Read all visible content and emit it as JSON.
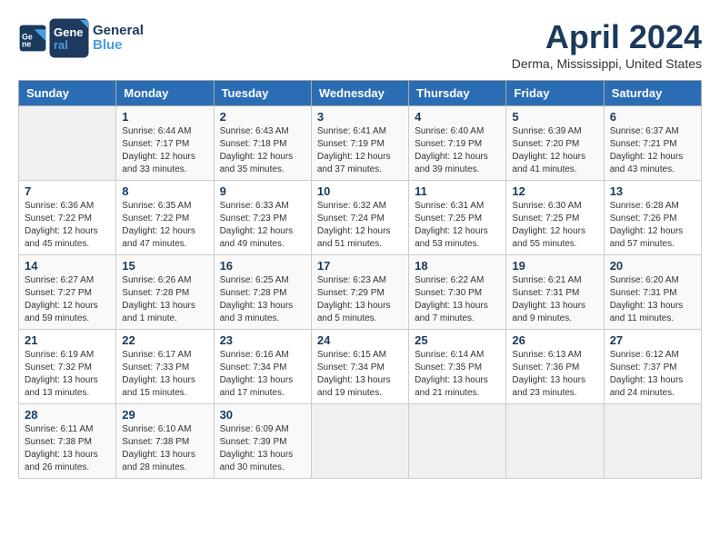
{
  "header": {
    "logo_line1": "General",
    "logo_line2": "Blue",
    "title": "April 2024",
    "location": "Derma, Mississippi, United States"
  },
  "days_of_week": [
    "Sunday",
    "Monday",
    "Tuesday",
    "Wednesday",
    "Thursday",
    "Friday",
    "Saturday"
  ],
  "weeks": [
    [
      {
        "day": "",
        "info": ""
      },
      {
        "day": "1",
        "info": "Sunrise: 6:44 AM\nSunset: 7:17 PM\nDaylight: 12 hours\nand 33 minutes."
      },
      {
        "day": "2",
        "info": "Sunrise: 6:43 AM\nSunset: 7:18 PM\nDaylight: 12 hours\nand 35 minutes."
      },
      {
        "day": "3",
        "info": "Sunrise: 6:41 AM\nSunset: 7:19 PM\nDaylight: 12 hours\nand 37 minutes."
      },
      {
        "day": "4",
        "info": "Sunrise: 6:40 AM\nSunset: 7:19 PM\nDaylight: 12 hours\nand 39 minutes."
      },
      {
        "day": "5",
        "info": "Sunrise: 6:39 AM\nSunset: 7:20 PM\nDaylight: 12 hours\nand 41 minutes."
      },
      {
        "day": "6",
        "info": "Sunrise: 6:37 AM\nSunset: 7:21 PM\nDaylight: 12 hours\nand 43 minutes."
      }
    ],
    [
      {
        "day": "7",
        "info": "Sunrise: 6:36 AM\nSunset: 7:22 PM\nDaylight: 12 hours\nand 45 minutes."
      },
      {
        "day": "8",
        "info": "Sunrise: 6:35 AM\nSunset: 7:22 PM\nDaylight: 12 hours\nand 47 minutes."
      },
      {
        "day": "9",
        "info": "Sunrise: 6:33 AM\nSunset: 7:23 PM\nDaylight: 12 hours\nand 49 minutes."
      },
      {
        "day": "10",
        "info": "Sunrise: 6:32 AM\nSunset: 7:24 PM\nDaylight: 12 hours\nand 51 minutes."
      },
      {
        "day": "11",
        "info": "Sunrise: 6:31 AM\nSunset: 7:25 PM\nDaylight: 12 hours\nand 53 minutes."
      },
      {
        "day": "12",
        "info": "Sunrise: 6:30 AM\nSunset: 7:25 PM\nDaylight: 12 hours\nand 55 minutes."
      },
      {
        "day": "13",
        "info": "Sunrise: 6:28 AM\nSunset: 7:26 PM\nDaylight: 12 hours\nand 57 minutes."
      }
    ],
    [
      {
        "day": "14",
        "info": "Sunrise: 6:27 AM\nSunset: 7:27 PM\nDaylight: 12 hours\nand 59 minutes."
      },
      {
        "day": "15",
        "info": "Sunrise: 6:26 AM\nSunset: 7:28 PM\nDaylight: 13 hours\nand 1 minute."
      },
      {
        "day": "16",
        "info": "Sunrise: 6:25 AM\nSunset: 7:28 PM\nDaylight: 13 hours\nand 3 minutes."
      },
      {
        "day": "17",
        "info": "Sunrise: 6:23 AM\nSunset: 7:29 PM\nDaylight: 13 hours\nand 5 minutes."
      },
      {
        "day": "18",
        "info": "Sunrise: 6:22 AM\nSunset: 7:30 PM\nDaylight: 13 hours\nand 7 minutes."
      },
      {
        "day": "19",
        "info": "Sunrise: 6:21 AM\nSunset: 7:31 PM\nDaylight: 13 hours\nand 9 minutes."
      },
      {
        "day": "20",
        "info": "Sunrise: 6:20 AM\nSunset: 7:31 PM\nDaylight: 13 hours\nand 11 minutes."
      }
    ],
    [
      {
        "day": "21",
        "info": "Sunrise: 6:19 AM\nSunset: 7:32 PM\nDaylight: 13 hours\nand 13 minutes."
      },
      {
        "day": "22",
        "info": "Sunrise: 6:17 AM\nSunset: 7:33 PM\nDaylight: 13 hours\nand 15 minutes."
      },
      {
        "day": "23",
        "info": "Sunrise: 6:16 AM\nSunset: 7:34 PM\nDaylight: 13 hours\nand 17 minutes."
      },
      {
        "day": "24",
        "info": "Sunrise: 6:15 AM\nSunset: 7:34 PM\nDaylight: 13 hours\nand 19 minutes."
      },
      {
        "day": "25",
        "info": "Sunrise: 6:14 AM\nSunset: 7:35 PM\nDaylight: 13 hours\nand 21 minutes."
      },
      {
        "day": "26",
        "info": "Sunrise: 6:13 AM\nSunset: 7:36 PM\nDaylight: 13 hours\nand 23 minutes."
      },
      {
        "day": "27",
        "info": "Sunrise: 6:12 AM\nSunset: 7:37 PM\nDaylight: 13 hours\nand 24 minutes."
      }
    ],
    [
      {
        "day": "28",
        "info": "Sunrise: 6:11 AM\nSunset: 7:38 PM\nDaylight: 13 hours\nand 26 minutes."
      },
      {
        "day": "29",
        "info": "Sunrise: 6:10 AM\nSunset: 7:38 PM\nDaylight: 13 hours\nand 28 minutes."
      },
      {
        "day": "30",
        "info": "Sunrise: 6:09 AM\nSunset: 7:39 PM\nDaylight: 13 hours\nand 30 minutes."
      },
      {
        "day": "",
        "info": ""
      },
      {
        "day": "",
        "info": ""
      },
      {
        "day": "",
        "info": ""
      },
      {
        "day": "",
        "info": ""
      }
    ]
  ]
}
